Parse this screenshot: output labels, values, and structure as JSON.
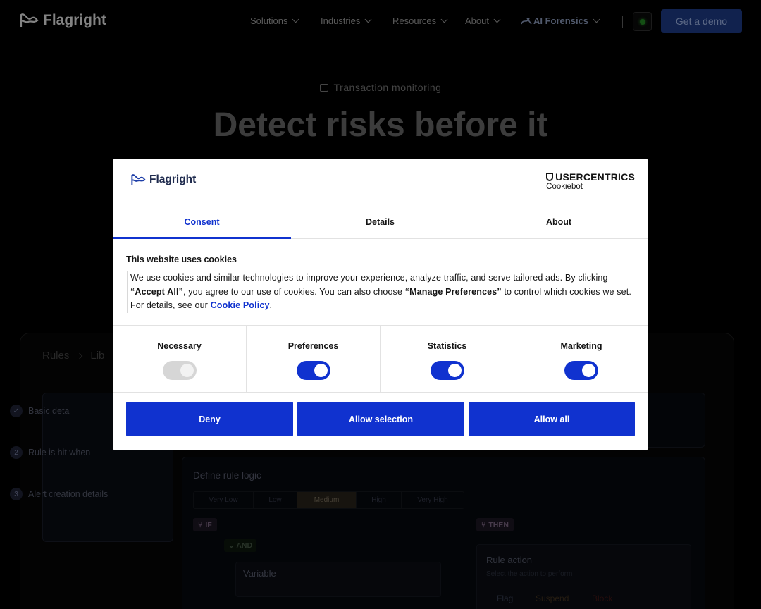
{
  "nav": {
    "brand": "Flagright",
    "items": [
      "Solutions",
      "Industries",
      "Resources",
      "About",
      "AI Forensics"
    ],
    "cta": "Get a demo"
  },
  "hero": {
    "eyebrow": "Transaction monitoring",
    "title": "Detect risks before it"
  },
  "app": {
    "breadcrumb": [
      "Rules",
      "Lib"
    ],
    "steps": [
      {
        "num": "✓",
        "label": "Basic deta"
      },
      {
        "num": "2",
        "label": "Rule is hit when"
      },
      {
        "num": "3",
        "label": "Alert creation details"
      }
    ],
    "logic_title": "Define rule logic",
    "risk_levels": [
      "Very Low",
      "Low",
      "Medium",
      "High",
      "Very High"
    ],
    "active_risk": "Medium",
    "if_tag": "IF",
    "then_tag": "THEN",
    "and_tag": "AND",
    "variable_label": "Variable",
    "rule_action": {
      "title": "Rule action",
      "subtitle": "Select the action to perform",
      "options": [
        "Flag",
        "Suspend",
        "Block"
      ]
    }
  },
  "consent": {
    "brand": "Flagright",
    "provider_top": "USERCENTRICS",
    "provider_sub": "Cookiebot",
    "tabs": [
      "Consent",
      "Details",
      "About"
    ],
    "active_tab": "Consent",
    "title": "This website uses cookies",
    "body_1": "We use cookies and similar technologies to improve your experience, analyze traffic, and serve tailored ads. By clicking ",
    "body_accept": "“Accept All”",
    "body_2": ", you agree to our use of cookies. You can also choose ",
    "body_manage": "“Manage Preferences”",
    "body_3": " to control which cookies we set. For details, see our ",
    "body_link": "Cookie Policy",
    "body_4": ".",
    "categories": [
      {
        "label": "Necessary",
        "on": true,
        "disabled": true
      },
      {
        "label": "Preferences",
        "on": true,
        "disabled": false
      },
      {
        "label": "Statistics",
        "on": true,
        "disabled": false
      },
      {
        "label": "Marketing",
        "on": true,
        "disabled": false
      }
    ],
    "buttons": {
      "deny": "Deny",
      "selection": "Allow selection",
      "all": "Allow all"
    },
    "accent": "#1032cf"
  }
}
